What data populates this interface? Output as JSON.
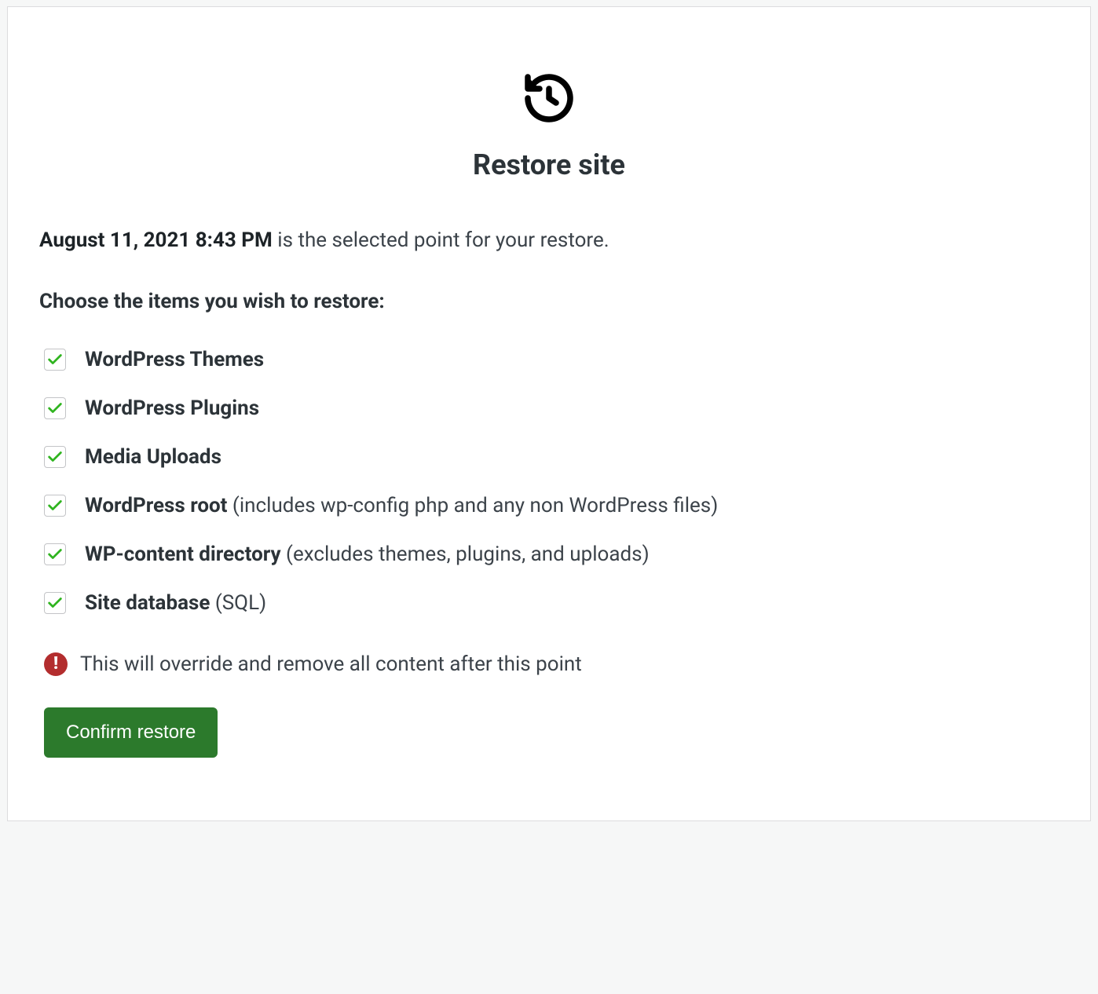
{
  "header": {
    "icon": "history-icon",
    "title": "Restore site"
  },
  "restore_point": {
    "timestamp": "August 11, 2021 8:43 PM",
    "suffix": " is the selected point for your restore."
  },
  "choose_label": "Choose the items you wish to restore:",
  "items": [
    {
      "id": "themes",
      "label": "WordPress Themes",
      "note": "",
      "checked": true
    },
    {
      "id": "plugins",
      "label": "WordPress Plugins",
      "note": "",
      "checked": true
    },
    {
      "id": "uploads",
      "label": "Media Uploads",
      "note": "",
      "checked": true
    },
    {
      "id": "root",
      "label": "WordPress root",
      "note": " (includes wp-config php and any non WordPress files)",
      "checked": true
    },
    {
      "id": "wp-content",
      "label": "WP-content directory",
      "note": " (excludes themes, plugins, and uploads)",
      "checked": true
    },
    {
      "id": "database",
      "label": "Site database",
      "note": " (SQL)",
      "checked": true
    }
  ],
  "warning": {
    "text": "This will override and remove all content after this point"
  },
  "actions": {
    "confirm_label": "Confirm restore"
  },
  "colors": {
    "primary_button": "#2c7a2c",
    "check_stroke": "#2fb41f",
    "warning_bg": "#b32d2e"
  }
}
